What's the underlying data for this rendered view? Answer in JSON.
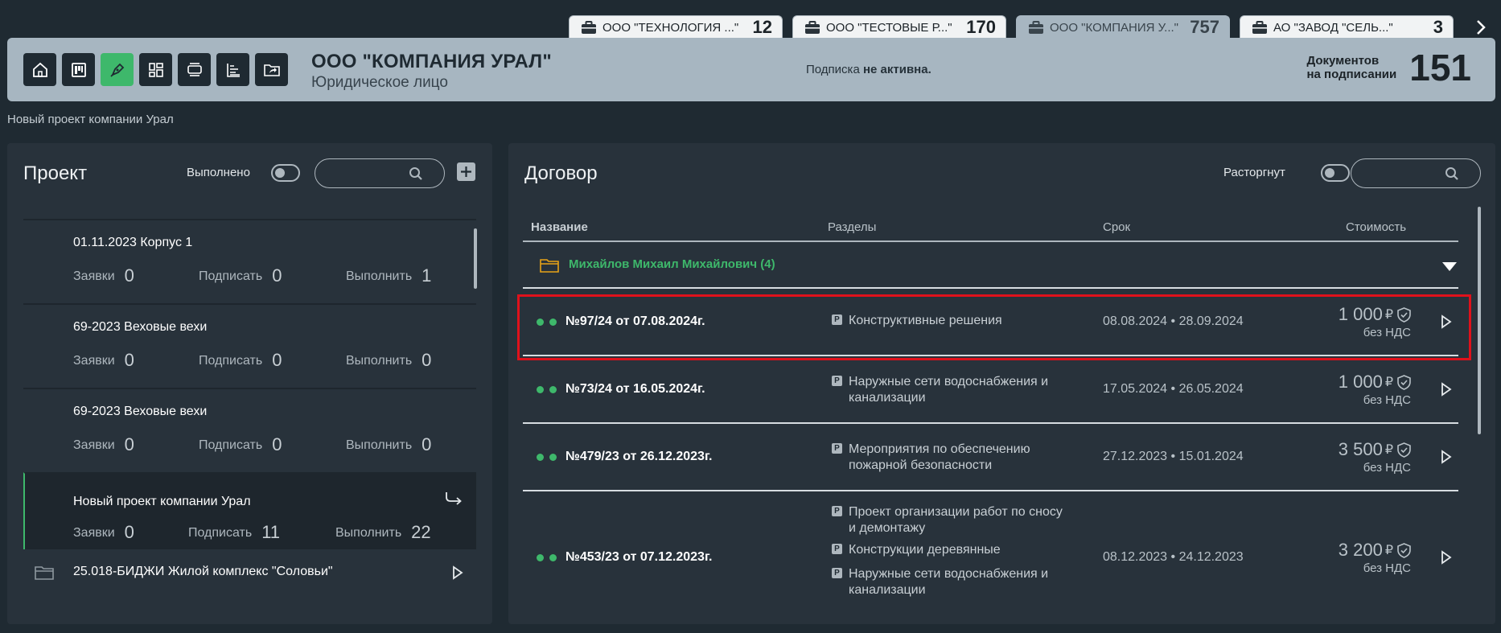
{
  "tabs": [
    {
      "name": "ООО \"ТЕХНОЛОГИЯ ...\"",
      "count": "12",
      "active": false
    },
    {
      "name": "ООО \"ТЕСТОВЫЕ Р...\"",
      "count": "170",
      "active": false
    },
    {
      "name": "ООО \"КОМПАНИЯ У...\"",
      "count": "757",
      "active": true
    },
    {
      "name": "АО \"ЗАВОД \"СЕЛЬ...\"",
      "count": "3",
      "active": false
    }
  ],
  "header": {
    "company_name": "ООО \"КОМПАНИЯ УРАЛ\"",
    "company_type": "Юридическое лицо",
    "subscription_label": "Подписка",
    "subscription_status": "не активна.",
    "docs_label_1": "Документов",
    "docs_label_2": "на подписании",
    "docs_count": "151"
  },
  "toolbar": [
    "home-icon",
    "kanban-icon",
    "pen-icon",
    "dashboard-icon",
    "list-icon",
    "tree-icon",
    "folder-share-icon"
  ],
  "breadcrumb": "Новый проект компании Урал",
  "project_panel": {
    "title": "Проект",
    "toggle_label": "Выполнено",
    "search_placeholder": "",
    "items": [
      {
        "name": "01.11.2023 Корпус 1",
        "requests_label": "Заявки",
        "requests": "0",
        "sign_label": "Подписать",
        "sign": "0",
        "do_label": "Выполнить",
        "do": "1"
      },
      {
        "name": "69-2023 Веховые вехи",
        "requests_label": "Заявки",
        "requests": "0",
        "sign_label": "Подписать",
        "sign": "0",
        "do_label": "Выполнить",
        "do": "0"
      },
      {
        "name": "69-2023 Веховые вехи",
        "requests_label": "Заявки",
        "requests": "0",
        "sign_label": "Подписать",
        "sign": "0",
        "do_label": "Выполнить",
        "do": "0"
      },
      {
        "name": "Новый проект компании Урал",
        "requests_label": "Заявки",
        "requests": "0",
        "sign_label": "Подписать",
        "sign": "11",
        "do_label": "Выполнить",
        "do": "22",
        "selected": true
      }
    ],
    "folder": {
      "name": "25.018-БИДЖИ Жилой комплекс \"Соловьи\""
    }
  },
  "contract_panel": {
    "title": "Договор",
    "toggle_label": "Расторгнут",
    "search_placeholder": "",
    "columns": {
      "name": "Название",
      "sections": "Разделы",
      "term": "Срок",
      "cost": "Стоимость"
    },
    "group": {
      "name": "Михайлов Михаил Михайлович (4)"
    },
    "rows": [
      {
        "number": "№97/24 от 07.08.2024г.",
        "sections": [
          "Конструктивные решения"
        ],
        "term": "08.08.2024 • 28.09.2024",
        "price": "1 000",
        "currency": "₽",
        "vat": "без НДС"
      },
      {
        "number": "№73/24 от 16.05.2024г.",
        "sections": [
          "Наружные сети водоснабжения и канализации"
        ],
        "term": "17.05.2024 • 26.05.2024",
        "price": "1 000",
        "currency": "₽",
        "vat": "без НДС"
      },
      {
        "number": "№479/23 от 26.12.2023г.",
        "sections": [
          "Мероприятия по обеспечению пожарной безопасности"
        ],
        "term": "27.12.2023 • 15.01.2024",
        "price": "3 500",
        "currency": "₽",
        "vat": "без НДС"
      },
      {
        "number": "№453/23 от 07.12.2023г.",
        "sections": [
          "Проект организации работ по сносу и демонтажу",
          "Конструкции деревянные",
          "Наружные сети водоснабжения и канализации"
        ],
        "term": "08.12.2023 • 24.12.2023",
        "price": "3 200",
        "currency": "₽",
        "vat": "без НДС"
      }
    ],
    "section_badge": "P"
  },
  "colors": {
    "accent": "#3eb86b",
    "header_bg": "#a7b6c1",
    "page_bg": "#1f2a32",
    "panel_bg": "#28323b",
    "folder": "#e8a317",
    "highlight": "#e0111b"
  }
}
